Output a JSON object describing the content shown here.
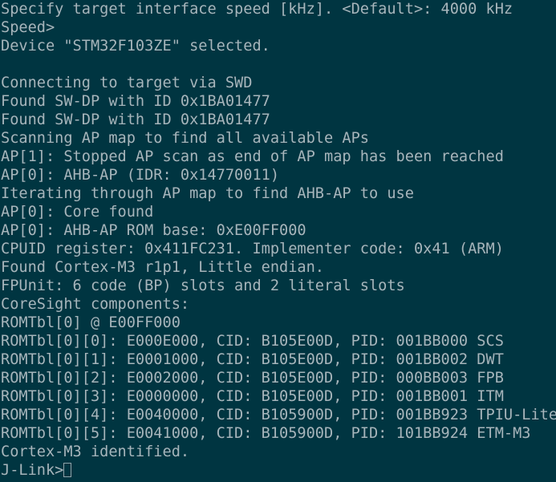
{
  "terminal": {
    "app": "J-Link Commander",
    "background_color": "#003541",
    "text_color": "#a7b5bb",
    "cursor_color": "#93a3a9",
    "cursor_style": "hollow-block",
    "columns": 62,
    "rows": 26,
    "lines": [
      "Specify target interface speed [kHz]. <Default>: 4000 kHz",
      "Speed>",
      "Device \"STM32F103ZE\" selected.",
      "",
      "Connecting to target via SWD",
      "Found SW-DP with ID 0x1BA01477",
      "Found SW-DP with ID 0x1BA01477",
      "Scanning AP map to find all available APs",
      "AP[1]: Stopped AP scan as end of AP map has been reached",
      "AP[0]: AHB-AP (IDR: 0x14770011)",
      "Iterating through AP map to find AHB-AP to use",
      "AP[0]: Core found",
      "AP[0]: AHB-AP ROM base: 0xE00FF000",
      "CPUID register: 0x411FC231. Implementer code: 0x41 (ARM)",
      "Found Cortex-M3 r1p1, Little endian.",
      "FPUnit: 6 code (BP) slots and 2 literal slots",
      "CoreSight components:",
      "ROMTbl[0] @ E00FF000",
      "ROMTbl[0][0]: E000E000, CID: B105E00D, PID: 001BB000 SCS",
      "ROMTbl[0][1]: E0001000, CID: B105E00D, PID: 001BB002 DWT",
      "ROMTbl[0][2]: E0002000, CID: B105E00D, PID: 000BB003 FPB",
      "ROMTbl[0][3]: E0000000, CID: B105E00D, PID: 001BB001 ITM",
      "ROMTbl[0][4]: E0040000, CID: B105900D, PID: 001BB923 TPIU-Lite",
      "ROMTbl[0][5]: E0041000, CID: B105900D, PID: 101BB924 ETM-M3",
      "Cortex-M3 identified."
    ],
    "prompt": {
      "text": "J-Link>",
      "input_value": ""
    }
  }
}
